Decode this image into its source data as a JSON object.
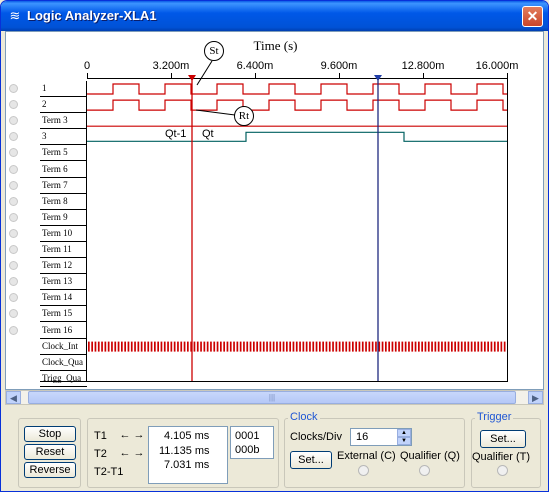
{
  "window": {
    "title": "Logic Analyzer-XLA1",
    "close_glyph": "✕",
    "icon": "analyzer-icon"
  },
  "plot": {
    "axis_title": "Time (s)",
    "ticks": [
      "0",
      "3.200m",
      "6.400m",
      "9.600m",
      "12.800m",
      "16.000m"
    ],
    "channels": [
      "1",
      "2",
      "Term 3",
      "3",
      "Term 5",
      "Term 6",
      "Term 7",
      "Term 8",
      "Term 9",
      "Term 10",
      "Term 11",
      "Term 12",
      "Term 13",
      "Term 14",
      "Term 15",
      "Term 16",
      "Clock_Int",
      "Clock_Qua",
      "Trigg_Qua"
    ],
    "annotations": {
      "st": "St",
      "rt": "Rt",
      "qt1": "Qt-1",
      "qt": "Qt"
    },
    "colors": {
      "channel": "#cc0000",
      "term3_wave": "#006060",
      "cursor_t1": "#cc0000",
      "cursor_t2": "#000080"
    }
  },
  "scroll": {
    "thumb_glyph": "|||",
    "left_glyph": "◀",
    "right_glyph": "▶"
  },
  "controls": {
    "stop": "Stop",
    "reset": "Reset",
    "reverse": "Reverse",
    "t1_label": "T1",
    "t2_label": "T2",
    "t2t1_label": "T2-T1",
    "t1_time": "4.105 ms",
    "t2_time": "11.135 ms",
    "diff_time": "7.031 ms",
    "t1_value": "0001",
    "t2_value": "000b",
    "arrow_left": "←",
    "arrow_right": "→"
  },
  "clock": {
    "group_title": "Clock",
    "clocks_per_div_label": "Clocks/Div",
    "clocks_per_div_value": "16",
    "set_label": "Set...",
    "external": "External (C)",
    "qualifier": "Qualifier (Q)"
  },
  "trigger": {
    "group_title": "Trigger",
    "set_label": "Set...",
    "qualifier": "Qualifier (T)"
  }
}
